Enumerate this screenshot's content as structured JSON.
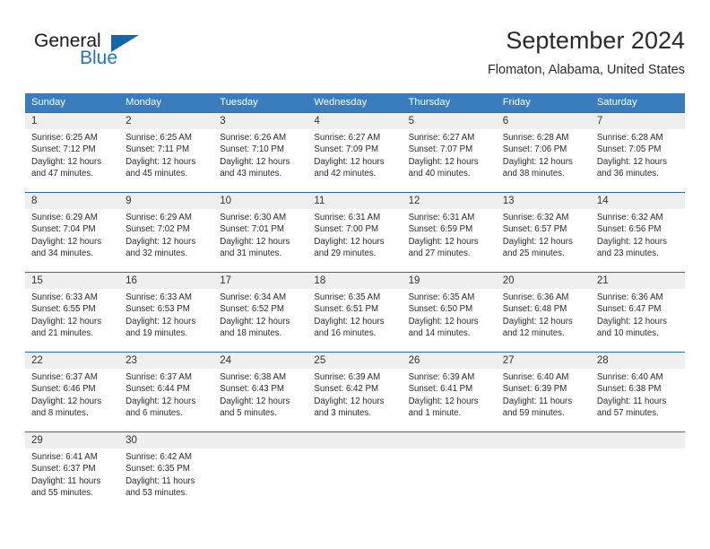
{
  "brand": {
    "name_part1": "General",
    "name_part2": "Blue",
    "logo_icon": "triangle-flag-icon"
  },
  "header": {
    "title": "September 2024",
    "subtitle": "Flomaton, Alabama, United States"
  },
  "colors": {
    "header_blue": "#3a7dbf",
    "row_divider_blue": "#2e6da4",
    "daynum_band": "#efefef",
    "brand_blue": "#1f77c0",
    "text": "#2a2a2a"
  },
  "weekday_headers": [
    "Sunday",
    "Monday",
    "Tuesday",
    "Wednesday",
    "Thursday",
    "Friday",
    "Saturday"
  ],
  "weeks": [
    {
      "days": [
        {
          "num": "1",
          "sunrise": "Sunrise: 6:25 AM",
          "sunset": "Sunset: 7:12 PM",
          "daylight1": "Daylight: 12 hours",
          "daylight2": "and 47 minutes."
        },
        {
          "num": "2",
          "sunrise": "Sunrise: 6:25 AM",
          "sunset": "Sunset: 7:11 PM",
          "daylight1": "Daylight: 12 hours",
          "daylight2": "and 45 minutes."
        },
        {
          "num": "3",
          "sunrise": "Sunrise: 6:26 AM",
          "sunset": "Sunset: 7:10 PM",
          "daylight1": "Daylight: 12 hours",
          "daylight2": "and 43 minutes."
        },
        {
          "num": "4",
          "sunrise": "Sunrise: 6:27 AM",
          "sunset": "Sunset: 7:09 PM",
          "daylight1": "Daylight: 12 hours",
          "daylight2": "and 42 minutes."
        },
        {
          "num": "5",
          "sunrise": "Sunrise: 6:27 AM",
          "sunset": "Sunset: 7:07 PM",
          "daylight1": "Daylight: 12 hours",
          "daylight2": "and 40 minutes."
        },
        {
          "num": "6",
          "sunrise": "Sunrise: 6:28 AM",
          "sunset": "Sunset: 7:06 PM",
          "daylight1": "Daylight: 12 hours",
          "daylight2": "and 38 minutes."
        },
        {
          "num": "7",
          "sunrise": "Sunrise: 6:28 AM",
          "sunset": "Sunset: 7:05 PM",
          "daylight1": "Daylight: 12 hours",
          "daylight2": "and 36 minutes."
        }
      ]
    },
    {
      "days": [
        {
          "num": "8",
          "sunrise": "Sunrise: 6:29 AM",
          "sunset": "Sunset: 7:04 PM",
          "daylight1": "Daylight: 12 hours",
          "daylight2": "and 34 minutes."
        },
        {
          "num": "9",
          "sunrise": "Sunrise: 6:29 AM",
          "sunset": "Sunset: 7:02 PM",
          "daylight1": "Daylight: 12 hours",
          "daylight2": "and 32 minutes."
        },
        {
          "num": "10",
          "sunrise": "Sunrise: 6:30 AM",
          "sunset": "Sunset: 7:01 PM",
          "daylight1": "Daylight: 12 hours",
          "daylight2": "and 31 minutes."
        },
        {
          "num": "11",
          "sunrise": "Sunrise: 6:31 AM",
          "sunset": "Sunset: 7:00 PM",
          "daylight1": "Daylight: 12 hours",
          "daylight2": "and 29 minutes."
        },
        {
          "num": "12",
          "sunrise": "Sunrise: 6:31 AM",
          "sunset": "Sunset: 6:59 PM",
          "daylight1": "Daylight: 12 hours",
          "daylight2": "and 27 minutes."
        },
        {
          "num": "13",
          "sunrise": "Sunrise: 6:32 AM",
          "sunset": "Sunset: 6:57 PM",
          "daylight1": "Daylight: 12 hours",
          "daylight2": "and 25 minutes."
        },
        {
          "num": "14",
          "sunrise": "Sunrise: 6:32 AM",
          "sunset": "Sunset: 6:56 PM",
          "daylight1": "Daylight: 12 hours",
          "daylight2": "and 23 minutes."
        }
      ]
    },
    {
      "days": [
        {
          "num": "15",
          "sunrise": "Sunrise: 6:33 AM",
          "sunset": "Sunset: 6:55 PM",
          "daylight1": "Daylight: 12 hours",
          "daylight2": "and 21 minutes."
        },
        {
          "num": "16",
          "sunrise": "Sunrise: 6:33 AM",
          "sunset": "Sunset: 6:53 PM",
          "daylight1": "Daylight: 12 hours",
          "daylight2": "and 19 minutes."
        },
        {
          "num": "17",
          "sunrise": "Sunrise: 6:34 AM",
          "sunset": "Sunset: 6:52 PM",
          "daylight1": "Daylight: 12 hours",
          "daylight2": "and 18 minutes."
        },
        {
          "num": "18",
          "sunrise": "Sunrise: 6:35 AM",
          "sunset": "Sunset: 6:51 PM",
          "daylight1": "Daylight: 12 hours",
          "daylight2": "and 16 minutes."
        },
        {
          "num": "19",
          "sunrise": "Sunrise: 6:35 AM",
          "sunset": "Sunset: 6:50 PM",
          "daylight1": "Daylight: 12 hours",
          "daylight2": "and 14 minutes."
        },
        {
          "num": "20",
          "sunrise": "Sunrise: 6:36 AM",
          "sunset": "Sunset: 6:48 PM",
          "daylight1": "Daylight: 12 hours",
          "daylight2": "and 12 minutes."
        },
        {
          "num": "21",
          "sunrise": "Sunrise: 6:36 AM",
          "sunset": "Sunset: 6:47 PM",
          "daylight1": "Daylight: 12 hours",
          "daylight2": "and 10 minutes."
        }
      ]
    },
    {
      "days": [
        {
          "num": "22",
          "sunrise": "Sunrise: 6:37 AM",
          "sunset": "Sunset: 6:46 PM",
          "daylight1": "Daylight: 12 hours",
          "daylight2": "and 8 minutes."
        },
        {
          "num": "23",
          "sunrise": "Sunrise: 6:37 AM",
          "sunset": "Sunset: 6:44 PM",
          "daylight1": "Daylight: 12 hours",
          "daylight2": "and 6 minutes."
        },
        {
          "num": "24",
          "sunrise": "Sunrise: 6:38 AM",
          "sunset": "Sunset: 6:43 PM",
          "daylight1": "Daylight: 12 hours",
          "daylight2": "and 5 minutes."
        },
        {
          "num": "25",
          "sunrise": "Sunrise: 6:39 AM",
          "sunset": "Sunset: 6:42 PM",
          "daylight1": "Daylight: 12 hours",
          "daylight2": "and 3 minutes."
        },
        {
          "num": "26",
          "sunrise": "Sunrise: 6:39 AM",
          "sunset": "Sunset: 6:41 PM",
          "daylight1": "Daylight: 12 hours",
          "daylight2": "and 1 minute."
        },
        {
          "num": "27",
          "sunrise": "Sunrise: 6:40 AM",
          "sunset": "Sunset: 6:39 PM",
          "daylight1": "Daylight: 11 hours",
          "daylight2": "and 59 minutes."
        },
        {
          "num": "28",
          "sunrise": "Sunrise: 6:40 AM",
          "sunset": "Sunset: 6:38 PM",
          "daylight1": "Daylight: 11 hours",
          "daylight2": "and 57 minutes."
        }
      ]
    },
    {
      "days": [
        {
          "num": "29",
          "sunrise": "Sunrise: 6:41 AM",
          "sunset": "Sunset: 6:37 PM",
          "daylight1": "Daylight: 11 hours",
          "daylight2": "and 55 minutes."
        },
        {
          "num": "30",
          "sunrise": "Sunrise: 6:42 AM",
          "sunset": "Sunset: 6:35 PM",
          "daylight1": "Daylight: 11 hours",
          "daylight2": "and 53 minutes."
        },
        {
          "num": "",
          "sunrise": "",
          "sunset": "",
          "daylight1": "",
          "daylight2": ""
        },
        {
          "num": "",
          "sunrise": "",
          "sunset": "",
          "daylight1": "",
          "daylight2": ""
        },
        {
          "num": "",
          "sunrise": "",
          "sunset": "",
          "daylight1": "",
          "daylight2": ""
        },
        {
          "num": "",
          "sunrise": "",
          "sunset": "",
          "daylight1": "",
          "daylight2": ""
        },
        {
          "num": "",
          "sunrise": "",
          "sunset": "",
          "daylight1": "",
          "daylight2": ""
        }
      ]
    }
  ]
}
